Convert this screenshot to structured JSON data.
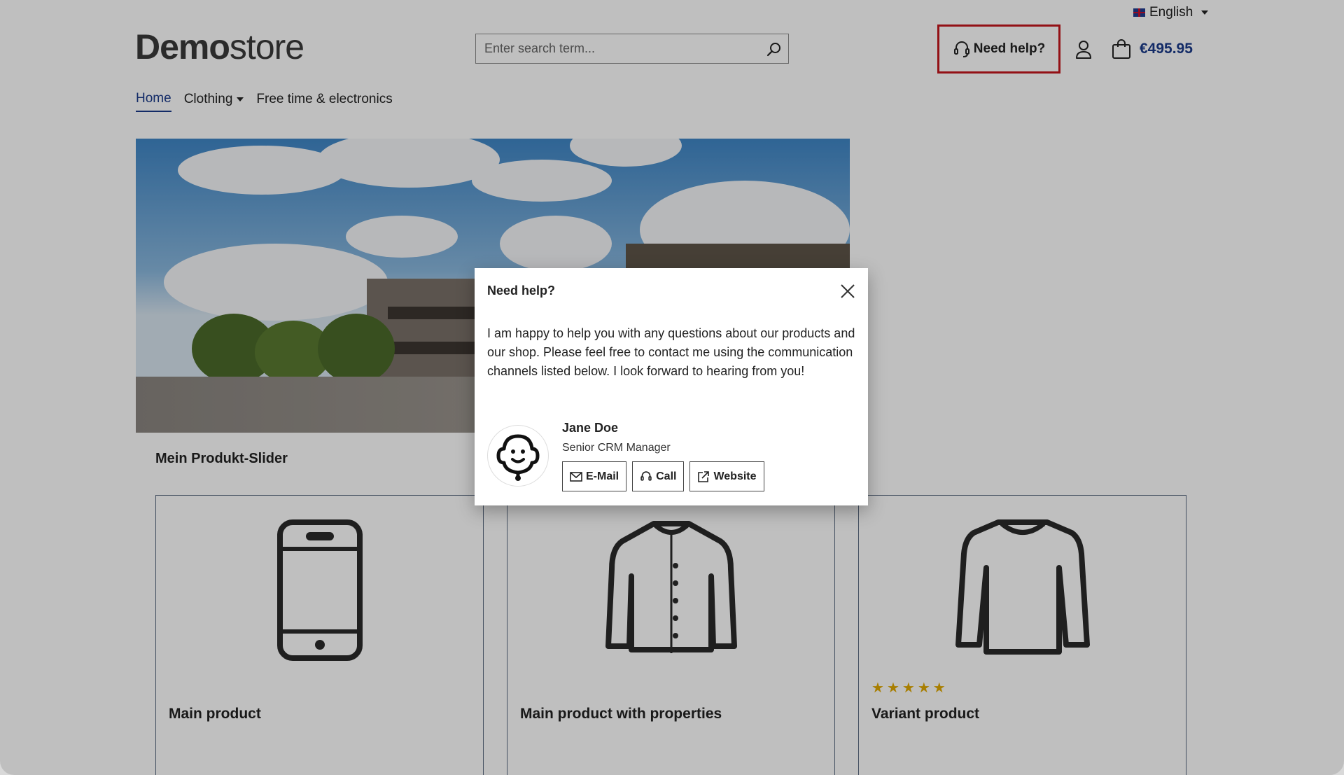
{
  "header": {
    "language": "English",
    "logo_bold": "Demo",
    "logo_light": "store",
    "search_placeholder": "Enter search term...",
    "need_help": "Need help?",
    "cart_total": "€495.95"
  },
  "nav": {
    "items": [
      {
        "label": "Home"
      },
      {
        "label": "Clothing"
      },
      {
        "label": "Free time & electronics"
      }
    ]
  },
  "slider": {
    "title": "Mein Produkt-Slider",
    "products": [
      {
        "name": "Main product",
        "icon": "smartphone-icon"
      },
      {
        "name": "Main product with properties",
        "icon": "jacket-icon"
      },
      {
        "name": "Variant product",
        "icon": "sweater-icon",
        "rating": 5
      }
    ]
  },
  "modal": {
    "title": "Need help?",
    "text": "I am happy to help you with any questions about our products and our shop. Please feel free to contact me using the communication channels listed below. I look forward to hearing from you!",
    "person_name": "Jane Doe",
    "person_role": "Senior CRM Manager",
    "buttons": {
      "email": "E-Mail",
      "call": "Call",
      "website": "Website"
    }
  },
  "colors": {
    "accent": "#1a3a8a",
    "highlight": "#c4161c",
    "star": "#e0a800"
  }
}
